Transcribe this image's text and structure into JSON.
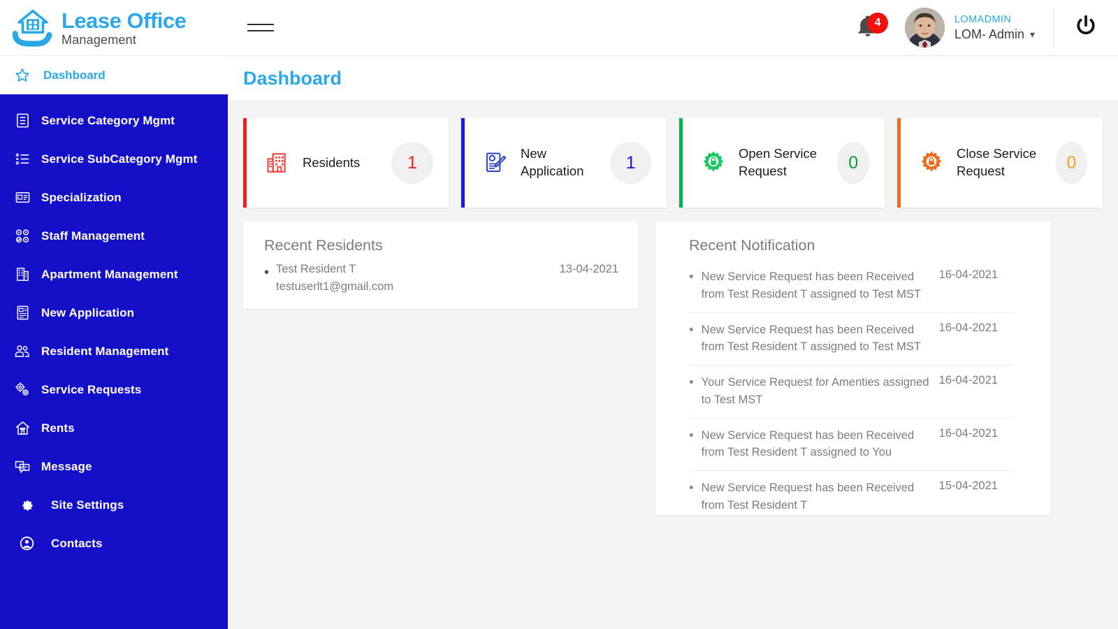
{
  "brand": {
    "title": "Lease Office",
    "subtitle": "Management",
    "logo_icon": "house-in-hand-icon"
  },
  "sidebar": {
    "active_item": {
      "label": "Dashboard",
      "icon": "star-icon"
    },
    "items": [
      {
        "label": "Service Category Mgmt",
        "icon": "document-list-icon"
      },
      {
        "label": "Service SubCategory Mgmt",
        "icon": "bulleted-list-icon"
      },
      {
        "label": "Specialization",
        "icon": "id-card-icon"
      },
      {
        "label": "Staff Management",
        "icon": "staff-group-icon"
      },
      {
        "label": "Apartment Management",
        "icon": "building-icon"
      },
      {
        "label": "New Application",
        "icon": "document-icon"
      },
      {
        "label": "Resident Management",
        "icon": "people-group-icon"
      },
      {
        "label": "Service Requests",
        "icon": "gears-icon"
      },
      {
        "label": "Rents",
        "icon": "house-rent-icon"
      },
      {
        "label": "Message",
        "icon": "chat-bubbles-icon"
      },
      {
        "label": "Site Settings",
        "icon": "gear-icon"
      },
      {
        "label": "Contacts",
        "icon": "user-circle-icon"
      }
    ]
  },
  "topbar": {
    "menu_icon": "hamburger-icon",
    "notification": {
      "icon": "bell-icon",
      "count": "4",
      "badge_color": "#f40d0d"
    },
    "user": {
      "avatar_icon": "user-avatar",
      "id": "LOMADMIN",
      "name": "LOM- Admin",
      "chevron_icon": "chevron-down-icon"
    },
    "power_icon": "power-icon"
  },
  "page": {
    "title": "Dashboard"
  },
  "stats": [
    {
      "label": "Residents",
      "count": "1",
      "icon": "building-red-icon",
      "accent": "#f01e1e",
      "count_color": "#f01e1e"
    },
    {
      "label": "New Application",
      "count": "1",
      "icon": "application-blue-icon",
      "accent": "#1a1ae0",
      "count_color": "#1a1ae0"
    },
    {
      "label": "Open Service Request",
      "count": "0",
      "icon": "gear-lock-green-icon",
      "accent": "#00b34a",
      "count_color": "#0a9b34"
    },
    {
      "label": "Close Service Request",
      "count": "0",
      "icon": "gear-lock-orange-icon",
      "accent": "#ef6c1a",
      "count_color": "#f2a01a"
    }
  ],
  "recent_residents": {
    "title": "Recent Residents",
    "items": [
      {
        "name": "Test Resident T",
        "email": "testuserlt1@gmail.com",
        "date": "13-04-2021"
      }
    ]
  },
  "recent_notification": {
    "title": "Recent Notification",
    "items": [
      {
        "text": "New Service Request has been Received from Test Resident T assigned to Test MST",
        "date": "16-04-2021"
      },
      {
        "text": "New Service Request has been Received from Test Resident T assigned to Test MST",
        "date": "16-04-2021"
      },
      {
        "text": "Your Service Request for Amenties assigned to Test MST",
        "date": "16-04-2021"
      },
      {
        "text": "New Service Request has been Received from Test Resident T assigned to You",
        "date": "16-04-2021"
      },
      {
        "text": "New Service Request has been Received from Test Resident T",
        "date": "15-04-2021"
      }
    ]
  }
}
